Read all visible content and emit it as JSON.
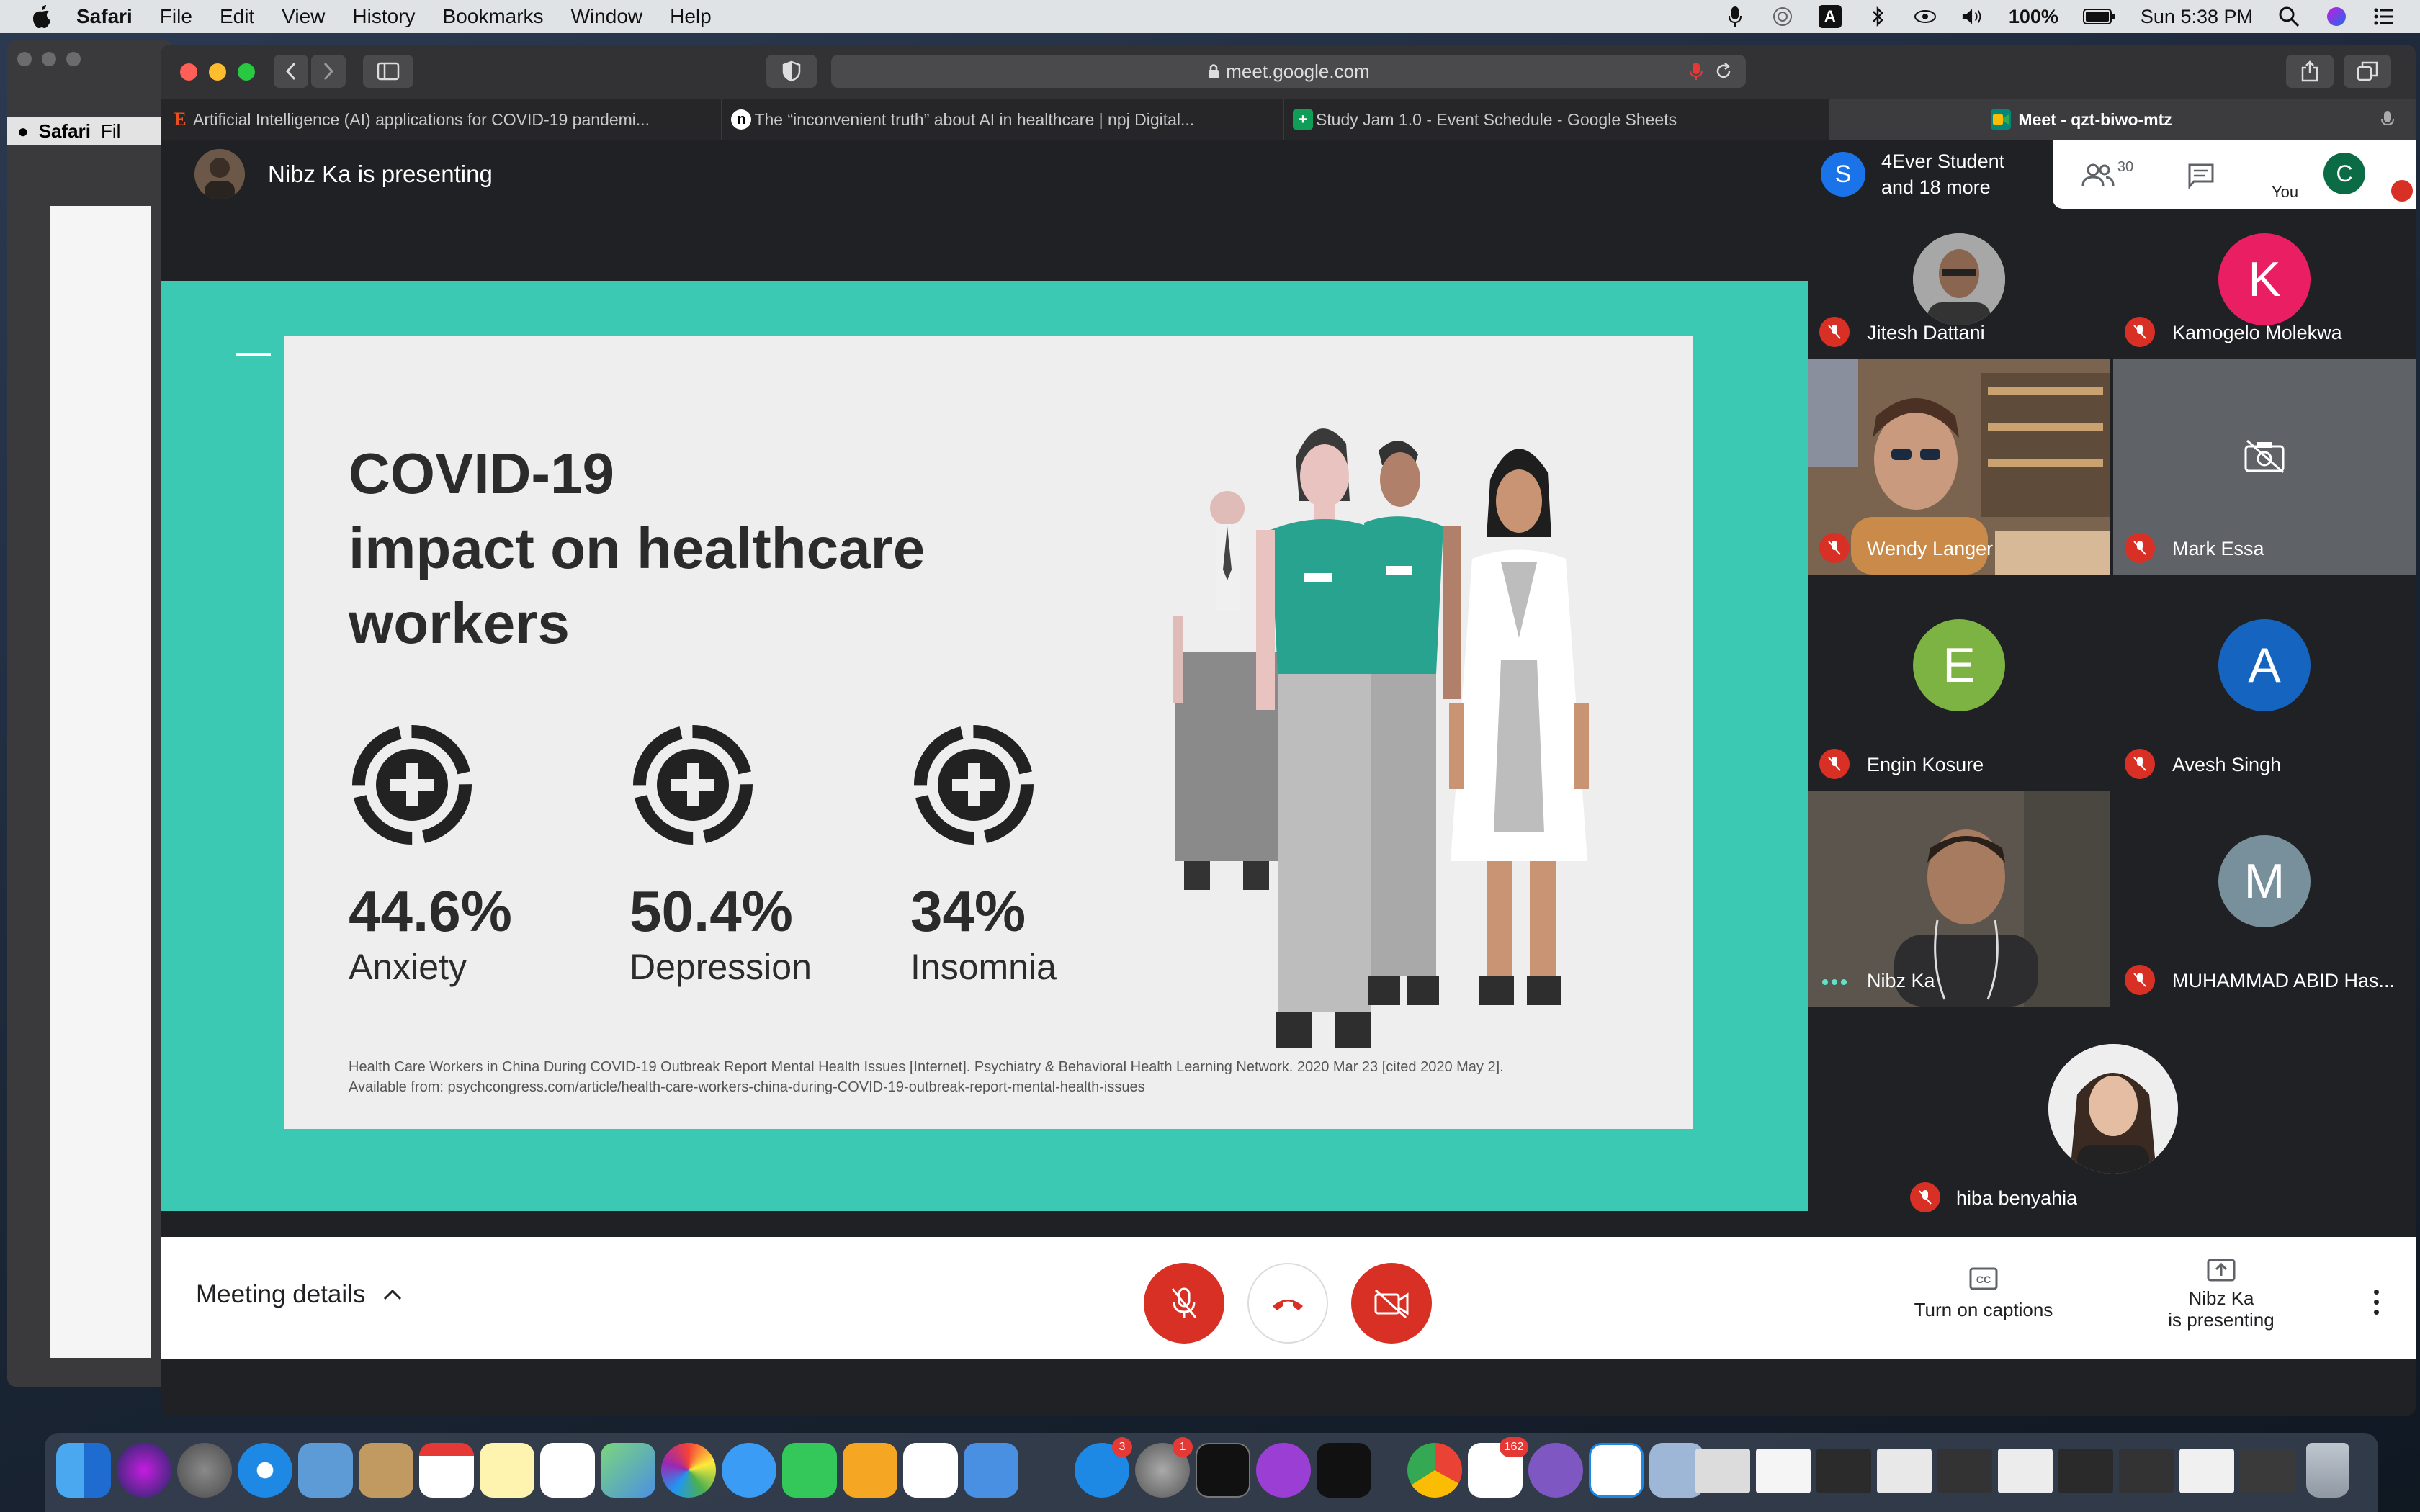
{
  "menubar": {
    "app_name": "Safari",
    "menus": [
      "File",
      "Edit",
      "View",
      "History",
      "Bookmarks",
      "Window",
      "Help"
    ],
    "battery": "100%",
    "clock": "Sun 5:38 PM",
    "input_source": "A"
  },
  "bg_window": {
    "menu_app": "Safari",
    "menu_file": "Fil"
  },
  "browser": {
    "url": "meet.google.com",
    "tabs": [
      {
        "favicon": "E",
        "favicon_color": "#e8501f",
        "title": "Artificial Intelligence (AI) applications for COVID-19 pandemi..."
      },
      {
        "favicon": "n",
        "favicon_color": "#000000",
        "title": "The “inconvenient truth” about AI in healthcare | npj Digital..."
      },
      {
        "favicon": "+",
        "favicon_color": "#0f9d58",
        "title": "Study Jam 1.0 - Event Schedule - Google Sheets"
      },
      {
        "favicon": "M",
        "favicon_color": "#00897b",
        "title": "Meet - qzt-biwo-mtz"
      }
    ]
  },
  "meet": {
    "presenting_label": "Nibz Ka is presenting",
    "slide": {
      "title_lines": [
        "COVID-19",
        "impact on healthcare",
        "workers"
      ],
      "stats": [
        {
          "value": "44.6%",
          "label": "Anxiety"
        },
        {
          "value": "50.4%",
          "label": "Depression"
        },
        {
          "value": "34%",
          "label": "Insomnia"
        }
      ],
      "citation_line1": "Health Care Workers in China During COVID-19 Outbreak Report Mental Health Issues [Internet]. Psychiatry & Behavioral Health Learning Network. 2020 Mar 23 [cited 2020 May 2].",
      "citation_line2": "Available from: psychcongress.com/article/health-care-workers-china-during-COVID-19-outbreak-report-mental-health-issues",
      "accent_color": "#3cc9b3"
    },
    "people_summary": {
      "avatar_letter": "S",
      "line1": "4Ever Student",
      "line2": "and 18 more"
    },
    "participant_count": "30",
    "self": {
      "avatar_letter": "C",
      "label": "You"
    },
    "participants": [
      {
        "name": "Jitesh Dattani",
        "kind": "photo"
      },
      {
        "name": "Kamogelo Molekwa",
        "kind": "letter",
        "letter": "K",
        "color": "#e91e63"
      },
      {
        "name": "Wendy Langer",
        "kind": "video"
      },
      {
        "name": "Mark Essa",
        "kind": "camera-off"
      },
      {
        "name": "Engin Kosure",
        "kind": "letter",
        "letter": "E",
        "color": "#7cb342"
      },
      {
        "name": "Avesh Singh",
        "kind": "letter",
        "letter": "A",
        "color": "#1565c0"
      },
      {
        "name": "Nibz Ka",
        "kind": "video"
      },
      {
        "name": "MUHAMMAD ABID Has...",
        "kind": "letter",
        "letter": "M",
        "color": "#78909c"
      },
      {
        "name": "hiba benyahia",
        "kind": "photo"
      }
    ],
    "bottom": {
      "meeting_details": "Meeting details",
      "captions_label": "Turn on captions",
      "presenting_line1": "Nibz Ka",
      "presenting_line2": "is presenting"
    }
  },
  "dock": {
    "badges": {
      "appstore": "3",
      "settings": "1",
      "slack": "162"
    }
  }
}
